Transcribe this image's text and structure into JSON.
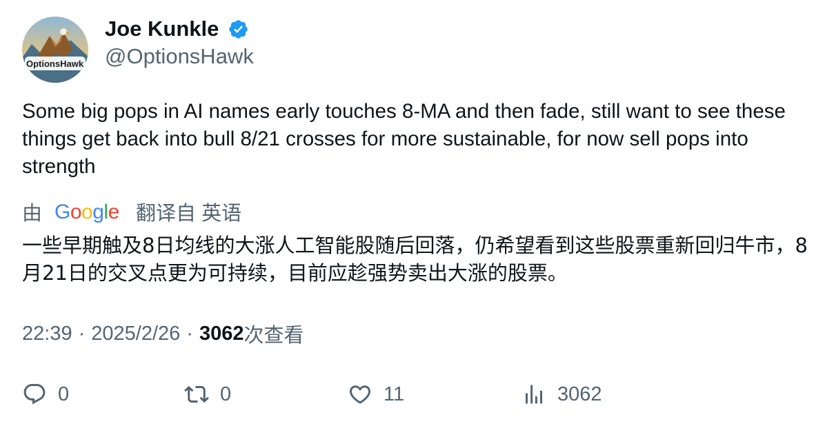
{
  "author": {
    "name": "Joe Kunkle",
    "handle": "@OptionsHawk",
    "avatar_text": "OptionsHawk",
    "verified_color": "#1d9bf0"
  },
  "tweet": {
    "text": "Some big pops in AI names early touches 8-MA and then fade, still want to see these things get back into bull 8/21 crosses for more sustainable, for now sell pops into strength"
  },
  "translation": {
    "by_label": "由",
    "provider": "Google",
    "from_label": "翻译自 英语",
    "text": "一些早期触及8日均线的大涨人工智能股随后回落，仍希望看到这些股票重新回归牛市，8月21日的交叉点更为可持续，目前应趁强势卖出大涨的股票。"
  },
  "meta": {
    "time": "22:39",
    "separator": "·",
    "date": "2025/2/26",
    "views_count": "3062",
    "views_label": "次查看"
  },
  "actions": {
    "replies": "0",
    "retweets": "0",
    "likes": "11",
    "views": "3062"
  }
}
